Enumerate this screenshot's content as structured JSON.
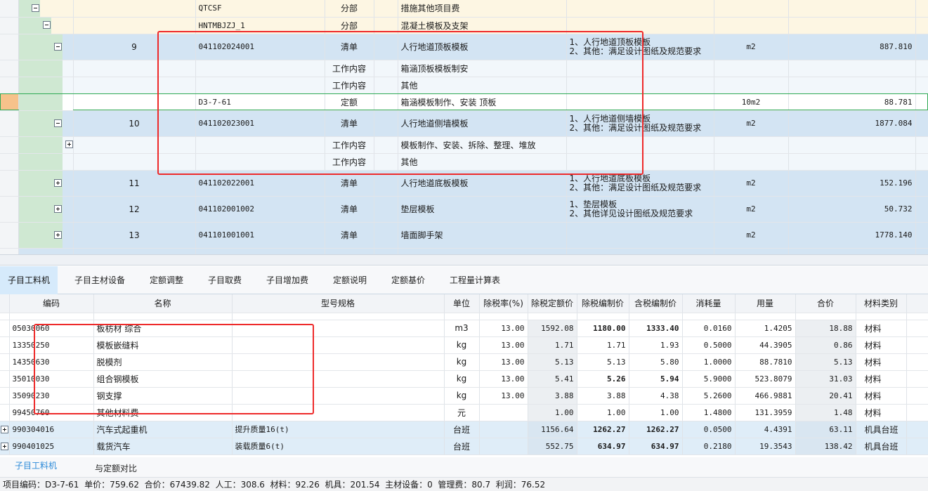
{
  "upper_rows": [
    {
      "kind": "section",
      "toggle": "minus",
      "toggle_indent": 44,
      "num": "",
      "code": "QTCSF",
      "type": "分部",
      "name": "措施其他项目费",
      "desc": [],
      "unit": "",
      "qty": ""
    },
    {
      "kind": "section",
      "toggle": "minus",
      "toggle_indent": 60,
      "num": "",
      "code": "HNTMBJZJ_1",
      "type": "分部",
      "name": "混凝土模板及支架",
      "desc": [],
      "unit": "",
      "qty": ""
    },
    {
      "kind": "item",
      "toggle": "minus",
      "toggle_indent": 76,
      "num": "9",
      "code": "041102024001",
      "type": "清单",
      "name": "人行地道顶板模板",
      "desc": [
        "1、人行地道顶板模板",
        "2、其他：满足设计图纸及规范要求"
      ],
      "unit": "m2",
      "qty": "887.810"
    },
    {
      "kind": "work",
      "toggle": "",
      "num": "",
      "code": "",
      "type": "工作内容",
      "name": "箱涵顶板模板制安",
      "desc": [],
      "unit": "",
      "qty": ""
    },
    {
      "kind": "work",
      "toggle": "",
      "num": "",
      "code": "",
      "type": "工作内容",
      "name": "其他",
      "desc": [],
      "unit": "",
      "qty": ""
    },
    {
      "kind": "quota",
      "toggle": "",
      "num": "",
      "code": "D3-7-61",
      "type": "定额",
      "name": "箱涵模板制作、安装 顶板",
      "desc": [],
      "unit": "10m2",
      "qty": "88.781"
    },
    {
      "kind": "item",
      "toggle": "minus",
      "toggle_indent": 76,
      "num": "10",
      "code": "041102023001",
      "type": "清单",
      "name": "人行地道侧墙模板",
      "desc": [
        "1、人行地道侧墙模板",
        "2、其他：满足设计图纸及规范要求"
      ],
      "unit": "m2",
      "qty": "1877.084"
    },
    {
      "kind": "work",
      "toggle": "plus",
      "toggle_indent": 92,
      "num": "",
      "code": "",
      "type": "工作内容",
      "name": "模板制作、安装、拆除、整理、堆放",
      "desc": [],
      "unit": "",
      "qty": ""
    },
    {
      "kind": "work",
      "toggle": "",
      "num": "",
      "code": "",
      "type": "工作内容",
      "name": "其他",
      "desc": [],
      "unit": "",
      "qty": ""
    },
    {
      "kind": "item",
      "toggle": "plus",
      "toggle_indent": 76,
      "num": "11",
      "code": "041102022001",
      "type": "清单",
      "name": "人行地道底板模板",
      "desc": [
        "1、人行地道底板模板",
        "2、其他：满足设计图纸及规范要求"
      ],
      "unit": "m2",
      "qty": "152.196"
    },
    {
      "kind": "item",
      "toggle": "plus",
      "toggle_indent": 76,
      "num": "12",
      "code": "041102001002",
      "type": "清单",
      "name": "垫层模板",
      "desc": [
        "1、垫层模板",
        "2、其他详见设计图纸及规范要求"
      ],
      "unit": "m2",
      "qty": "50.732"
    },
    {
      "kind": "item",
      "toggle": "plus",
      "toggle_indent": 76,
      "num": "13",
      "code": "041101001001",
      "type": "清单",
      "name": "墙面脚手架",
      "desc": [],
      "unit": "m2",
      "qty": "1778.140"
    }
  ],
  "tabs": [
    "子目工料机",
    "子目主材设备",
    "定额调整",
    "子目取费",
    "子目增加费",
    "定额说明",
    "定额基价",
    "工程量计算表"
  ],
  "lower_headers": [
    "编码",
    "名称",
    "型号规格",
    "单位",
    "除税率(%)",
    "除税定额价",
    "除税编制价",
    "含税编制价",
    "消耗量",
    "用量",
    "合价",
    "材料类别"
  ],
  "lower_rows": [
    {
      "kind": "mat",
      "toggle": "",
      "code": "05030060",
      "name": "板枋材 综合",
      "spec": "",
      "unit": "m3",
      "rate": "13.00",
      "base": "1592.08",
      "net": "1180.00",
      "gross": "1333.40",
      "cons": "0.0160",
      "used": "1.4205",
      "total": "18.88",
      "cat": "材料",
      "bold": true
    },
    {
      "kind": "mat",
      "toggle": "",
      "code": "13350250",
      "name": "模板嵌缝料",
      "spec": "",
      "unit": "kg",
      "rate": "13.00",
      "base": "1.71",
      "net": "1.71",
      "gross": "1.93",
      "cons": "0.5000",
      "used": "44.3905",
      "total": "0.86",
      "cat": "材料",
      "bold": false
    },
    {
      "kind": "mat",
      "toggle": "",
      "code": "14350630",
      "name": "脱模剂",
      "spec": "",
      "unit": "kg",
      "rate": "13.00",
      "base": "5.13",
      "net": "5.13",
      "gross": "5.80",
      "cons": "1.0000",
      "used": "88.7810",
      "total": "5.13",
      "cat": "材料",
      "bold": false
    },
    {
      "kind": "mat",
      "toggle": "",
      "code": "35010030",
      "name": "组合钢模板",
      "spec": "",
      "unit": "kg",
      "rate": "13.00",
      "base": "5.41",
      "net": "5.26",
      "gross": "5.94",
      "cons": "5.9000",
      "used": "523.8079",
      "total": "31.03",
      "cat": "材料",
      "bold": true
    },
    {
      "kind": "mat",
      "toggle": "",
      "code": "35090230",
      "name": "钢支撑",
      "spec": "",
      "unit": "kg",
      "rate": "13.00",
      "base": "3.88",
      "net": "3.88",
      "gross": "4.38",
      "cons": "5.2600",
      "used": "466.9881",
      "total": "20.41",
      "cat": "材料",
      "bold": false
    },
    {
      "kind": "mat",
      "toggle": "",
      "code": "99450760",
      "name": "其他材料费",
      "spec": "",
      "unit": "元",
      "rate": "",
      "base": "1.00",
      "net": "1.00",
      "gross": "1.00",
      "cons": "1.4800",
      "used": "131.3959",
      "total": "1.48",
      "cat": "材料",
      "bold": false
    },
    {
      "kind": "mach",
      "toggle": "plus",
      "code": "990304016",
      "name": "汽车式起重机",
      "spec": "提升质量16(t)",
      "unit": "台班",
      "rate": "",
      "base": "1156.64",
      "net": "1262.27",
      "gross": "1262.27",
      "cons": "0.0500",
      "used": "4.4391",
      "total": "63.11",
      "cat": "机具台班",
      "bold": true
    },
    {
      "kind": "mach",
      "toggle": "plus",
      "code": "990401025",
      "name": "载货汽车",
      "spec": "装载质量6(t)",
      "unit": "台班",
      "rate": "",
      "base": "552.75",
      "net": "634.97",
      "gross": "634.97",
      "cons": "0.2180",
      "used": "19.3543",
      "total": "138.42",
      "cat": "机具台班",
      "bold": true
    }
  ],
  "bottom_tabs": [
    "子目工料机",
    "与定额对比"
  ],
  "status": {
    "text": "项目编码：D3-7-61  单价：759.62  合价：67439.82  人工：308.6  材料：92.26  机具：201.54  主材设备：0  管理费：80.7  利润：76.52"
  },
  "colors": {
    "section_bg": "#fdf6e3",
    "item_bg": "#d3e4f3",
    "work_bg": "#f2f7fb",
    "tab_active": "#d6eafb",
    "machine_bg": "#dfedf8",
    "highlight": "#ee2a2a",
    "tree_green": "#cfe8d2"
  }
}
